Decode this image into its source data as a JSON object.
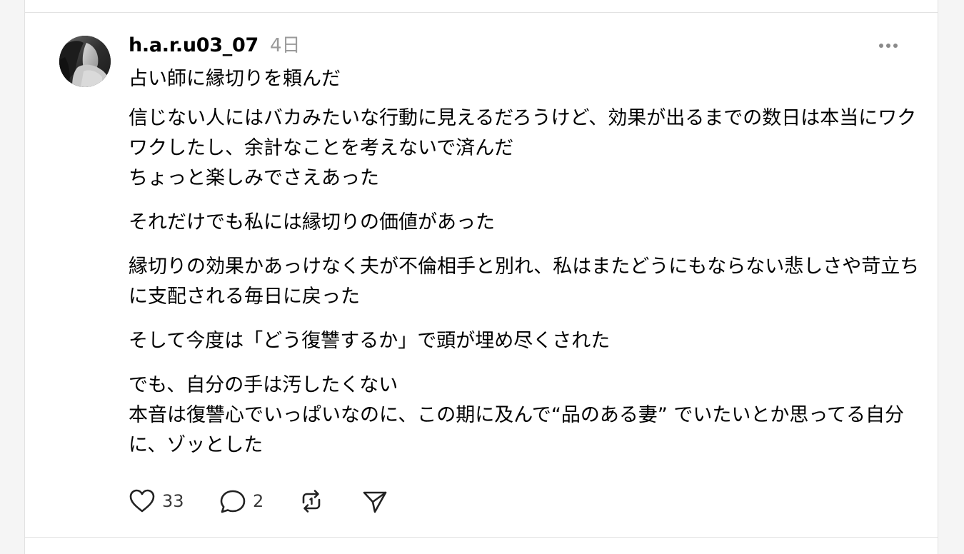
{
  "post": {
    "author": "h.a.r.u03_07",
    "timestamp": "4日",
    "avatar_icon": "user-avatar-photo",
    "paragraphs": [
      "占い師に縁切りを頼んだ",
      "信じない人にはバカみたいな行動に見えるだろうけど、効果が出るまでの数日は本当にワクワクしたし、余計なことを考えないで済んだ\nちょっと楽しみでさえあった",
      "それだけでも私には縁切りの価値があった",
      "縁切りの効果かあっけなく夫が不倫相手と別れ、私はまたどうにもならない悲しさや苛立ちに支配される毎日に戻った",
      "そして今度は「どう復讐するか」で頭が埋め尽くされた",
      "でも、自分の手は汚したくない\n本音は復讐心でいっぱいなのに、この期に及んで“品のある妻” でいたいとか思ってる自分に、ゾッとした"
    ],
    "actions": {
      "like_count": "33",
      "reply_count": "2",
      "like_icon": "heart-icon",
      "reply_icon": "comment-bubble-icon",
      "repost_icon": "repost-icon",
      "share_icon": "send-icon",
      "more_icon": "more-dots-icon"
    }
  },
  "colors": {
    "background": "#f5f5f5",
    "card": "#ffffff",
    "divider": "#e2e2e2",
    "muted_text": "#9a9a9a",
    "icon": "#333333"
  }
}
